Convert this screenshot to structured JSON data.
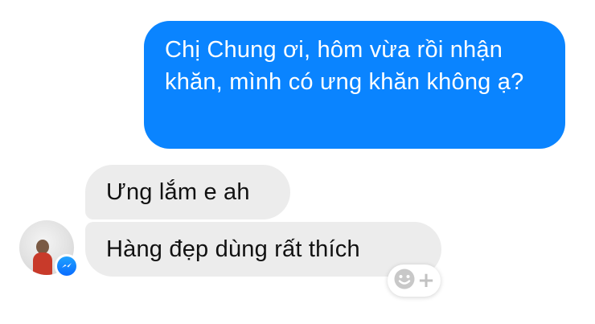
{
  "conversation": {
    "messages": [
      {
        "direction": "outgoing",
        "text": "Chị Chung ơi, hôm vừa rồi nhận khăn, mình có ưng khăn không ạ?"
      },
      {
        "direction": "incoming",
        "text": "Ưng lắm e ah"
      },
      {
        "direction": "incoming",
        "text": "Hàng đẹp dùng rất thích"
      }
    ]
  },
  "sender": {
    "avatar_icon": "profile-photo",
    "badge_icon": "messenger-icon"
  },
  "reaction": {
    "icon": "smiley-add-reaction-icon",
    "plus": "+"
  },
  "colors": {
    "outgoing_bubble": "#0a84ff",
    "incoming_bubble": "#ececec",
    "messenger_badge": "#0a7cff"
  }
}
